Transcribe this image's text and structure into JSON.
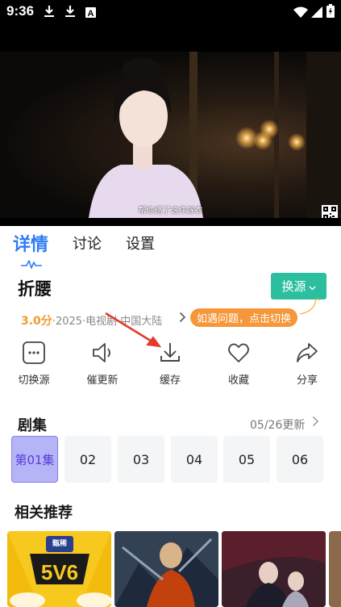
{
  "status_bar": {
    "time": "9:36",
    "left_icons": [
      "download-icon",
      "download-icon",
      "text-a-icon"
    ],
    "right_icons": [
      "wifi-icon",
      "signal-icon",
      "battery-icon"
    ]
  },
  "video": {
    "subtitle": "帮你绣了这件嫁衣"
  },
  "tabs": [
    {
      "label": "详情",
      "active": true
    },
    {
      "label": "讨论",
      "active": false
    },
    {
      "label": "设置",
      "active": false
    }
  ],
  "detail": {
    "title": "折腰",
    "switch_source_label": "换源",
    "score": "3.0分",
    "meta": "·2025·电视剧·中国大陆",
    "tip": "如遇问题，点击切换"
  },
  "actions": [
    {
      "label": "切换源",
      "icon": "switch-source-icon"
    },
    {
      "label": "催更新",
      "icon": "speaker-icon"
    },
    {
      "label": "缓存",
      "icon": "download-icon"
    },
    {
      "label": "收藏",
      "icon": "heart-icon"
    },
    {
      "label": "分享",
      "icon": "share-icon"
    }
  ],
  "episodes": {
    "header": "剧集",
    "update_text": "05/26更新",
    "items": [
      "第01集",
      "02",
      "03",
      "04",
      "05",
      "06"
    ],
    "active_index": 0
  },
  "recommendations": {
    "header": "相关推荐",
    "cards": [
      {
        "badge": "甄稀"
      },
      {},
      {},
      {}
    ]
  },
  "colors": {
    "accent_blue": "#2f7cf6",
    "source_button": "#2bbf9f",
    "score_orange": "#f29a2e",
    "tip_orange": "#f5973a",
    "episode_active_bg": "#b4b4f7",
    "annotation_red": "#e53b2c"
  }
}
